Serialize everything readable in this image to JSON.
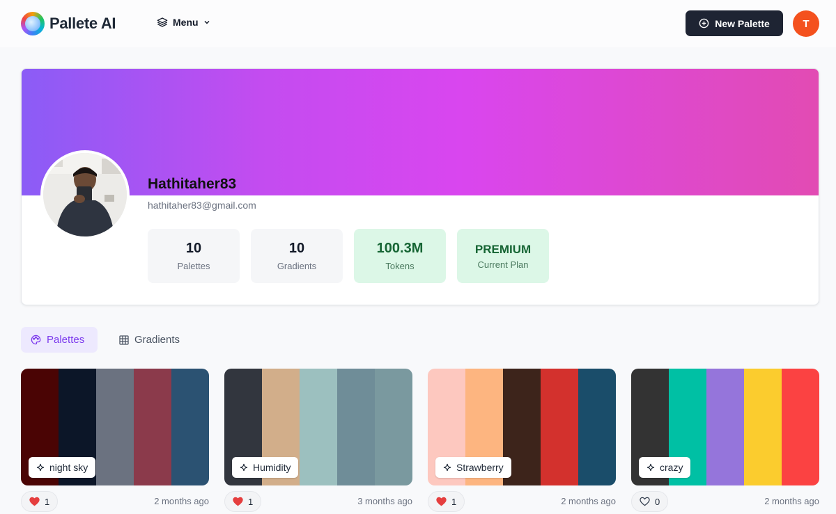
{
  "header": {
    "app_name": "Pallete AI",
    "menu_label": "Menu",
    "new_button_label": "New Palette",
    "user_initial": "T"
  },
  "profile": {
    "username": "Hathitaher83",
    "email": "hathitaher83@gmail.com",
    "stats": [
      {
        "value": "10",
        "label": "Palettes"
      },
      {
        "value": "10",
        "label": "Gradients"
      },
      {
        "value": "100.3M",
        "label": "Tokens"
      },
      {
        "value": "PREMIUM",
        "label": "Current Plan"
      }
    ]
  },
  "tabs": [
    {
      "label": "Palettes",
      "active": true
    },
    {
      "label": "Gradients",
      "active": false
    }
  ],
  "palettes": [
    {
      "name": "night sky",
      "colors": [
        "#4a0404",
        "#0c1628",
        "#6b7280",
        "#8b3a4b",
        "#2b5272"
      ],
      "likes": "1",
      "liked": true,
      "age": "2 months ago"
    },
    {
      "name": "Humidity",
      "colors": [
        "#32363e",
        "#d2ae8a",
        "#9cc0bf",
        "#6f8d98",
        "#7a999f"
      ],
      "likes": "1",
      "liked": true,
      "age": "3 months ago"
    },
    {
      "name": "Strawberry",
      "colors": [
        "#fdc8bf",
        "#fdb580",
        "#3d241b",
        "#d3312d",
        "#1a4d6a"
      ],
      "likes": "1",
      "liked": true,
      "age": "2 months ago"
    },
    {
      "name": "crazy",
      "colors": [
        "#333333",
        "#00c0a4",
        "#9575db",
        "#fbcc2e",
        "#fb4242"
      ],
      "likes": "0",
      "liked": false,
      "age": "2 months ago"
    }
  ]
}
